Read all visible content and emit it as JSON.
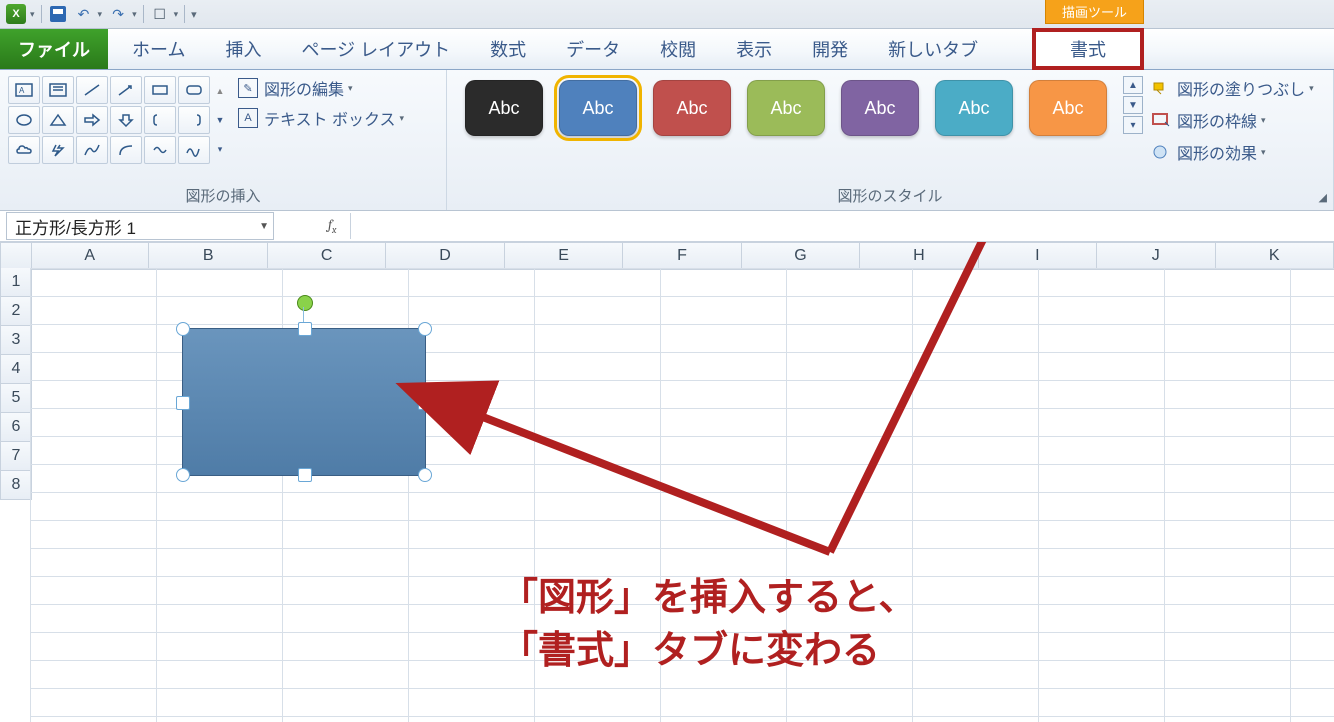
{
  "qat": {
    "excel_initial": "X",
    "drawing_tools_label": "描画ツール"
  },
  "tabs": {
    "file": "ファイル",
    "home": "ホーム",
    "insert": "挿入",
    "page_layout": "ページ レイアウト",
    "formulas": "数式",
    "data": "データ",
    "review": "校閲",
    "view": "表示",
    "dev": "開発",
    "new_tab": "新しいタブ",
    "format": "書式"
  },
  "ribbon": {
    "insert_shapes_label": "図形の挿入",
    "edit_shape": "図形の編集",
    "text_box": "テキスト ボックス",
    "styles_label": "図形のスタイル",
    "style_sample": "Abc",
    "style_colors": [
      "#2b2b2b",
      "#4f81bd",
      "#c0504d",
      "#9bbb59",
      "#8064a2",
      "#4bacc6",
      "#f79646"
    ],
    "fill": "図形の塗りつぶし",
    "outline": "図形の枠線",
    "effects": "図形の効果"
  },
  "formula_bar": {
    "name": "正方形/長方形 1",
    "fx": "fx"
  },
  "columns": [
    "A",
    "B",
    "C",
    "D",
    "E",
    "F",
    "G",
    "H",
    "I",
    "J",
    "K"
  ],
  "rows": [
    "1",
    "2",
    "3",
    "4",
    "5",
    "6",
    "7",
    "8"
  ],
  "annotation": {
    "line1": "「図形」を挿入すると、",
    "line2": "「書式」タブに変わる"
  }
}
